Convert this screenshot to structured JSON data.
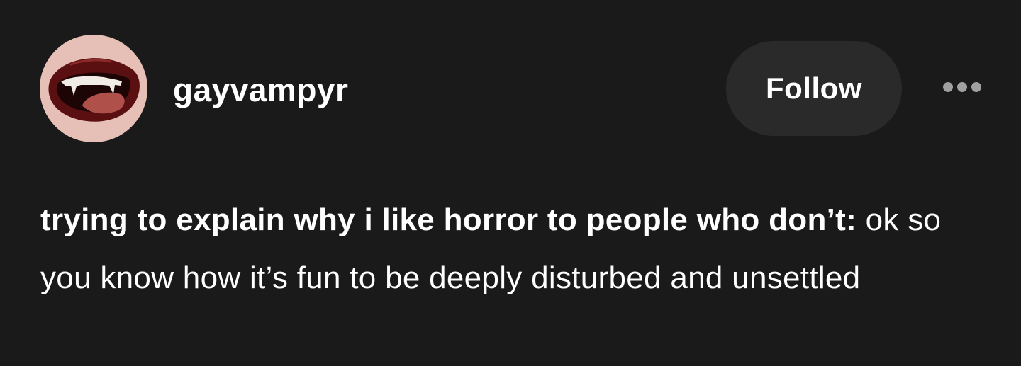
{
  "post": {
    "author": {
      "username": "gayvampyr",
      "avatar_icon": "vampire-mouth-icon"
    },
    "follow_label": "Follow",
    "more_icon": "more-options-icon",
    "body": {
      "bold_text": "trying to explain why i like horror to people who don’t:",
      "regular_text": "ok so you know how it’s fun to be deeply disturbed and unsettled"
    }
  },
  "colors": {
    "background": "#1a1a1a",
    "text": "#ffffff",
    "button_background": "#2a2a2a",
    "more_icon": "#a0a0a0",
    "avatar_background": "#e6c0b6"
  }
}
